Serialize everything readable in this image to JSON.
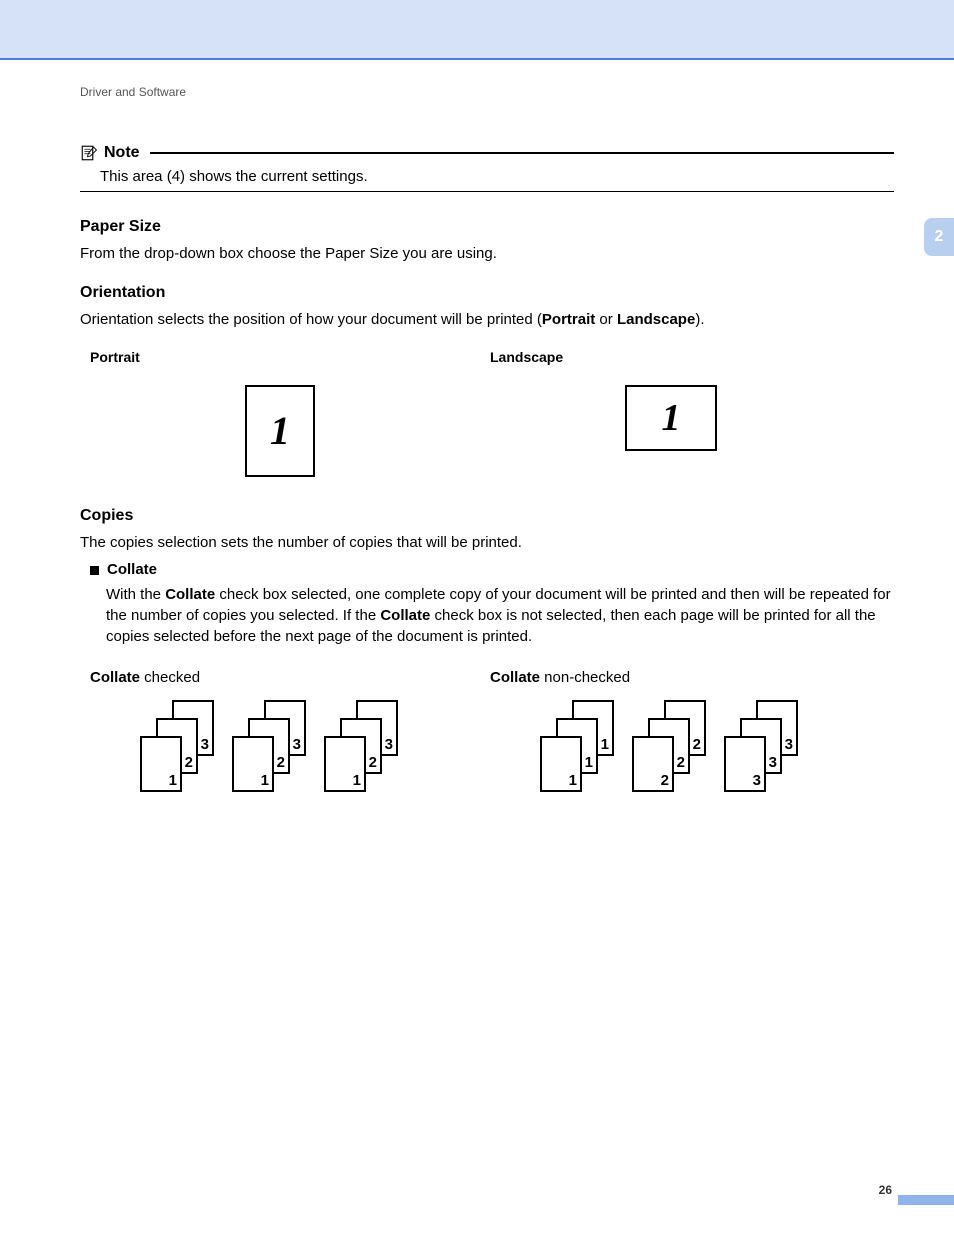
{
  "breadcrumb": "Driver and Software",
  "chapter_tab": "2",
  "note": {
    "label": "Note",
    "body": "This area (4) shows the current settings."
  },
  "paper_size": {
    "heading": "Paper Size",
    "body": "From the drop-down box choose the Paper Size you are using."
  },
  "orientation": {
    "heading": "Orientation",
    "body_pre": "Orientation selects the position of how your document will be printed (",
    "bold1": "Portrait",
    "mid": " or ",
    "bold2": "Landscape",
    "body_post": ").",
    "portrait_label": "Portrait",
    "landscape_label": "Landscape",
    "sample_digit": "1"
  },
  "copies": {
    "heading": "Copies",
    "body": "The copies selection sets the number of copies that will be printed.",
    "collate_label": "Collate",
    "collate_body_1": "With the ",
    "collate_bold_1": "Collate",
    "collate_body_2": " check box selected, one complete copy of your document will be printed and then will be repeated for the number of copies you selected. If the ",
    "collate_bold_2": "Collate",
    "collate_body_3": " check box is not selected, then each page will be printed for all the copies selected before the next page of the document is printed.",
    "checked_label_bold": "Collate",
    "checked_label_rest": " checked",
    "nonchecked_label_bold": "Collate",
    "nonchecked_label_rest": " non-checked",
    "checked_stacks": [
      [
        "1",
        "2",
        "3"
      ],
      [
        "1",
        "2",
        "3"
      ],
      [
        "1",
        "2",
        "3"
      ]
    ],
    "nonchecked_stacks": [
      [
        "1",
        "1",
        "1"
      ],
      [
        "2",
        "2",
        "2"
      ],
      [
        "3",
        "3",
        "3"
      ]
    ]
  },
  "page_number": "26"
}
